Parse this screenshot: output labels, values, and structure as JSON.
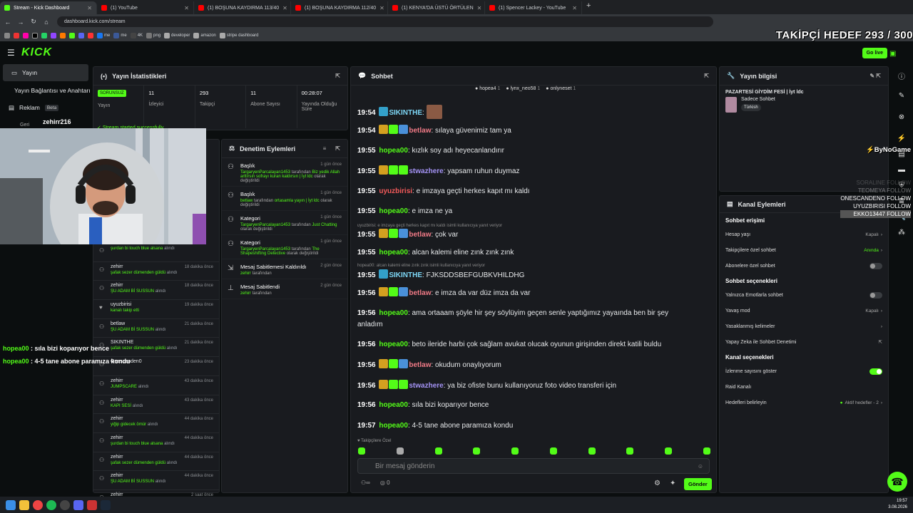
{
  "browser": {
    "tabs": [
      {
        "title": "Stream - Kick Dashboard",
        "active": true
      },
      {
        "title": "(1) YouTube"
      },
      {
        "title": "(1) BOŞUNA KAYDIRMA 113/40"
      },
      {
        "title": "(1) BOŞUNA KAYDIRMA 112/40"
      },
      {
        "title": "(1) KENYA'DA ÜSTÜ ÖRTÜLEN"
      },
      {
        "title": "(1) Spencer Lackey - YouTube"
      }
    ],
    "url": "dashboard.kick.com/stream",
    "bookmarks": [
      "me",
      "me",
      "4K",
      "png",
      "developer",
      "amazon",
      "stripe dashboard"
    ]
  },
  "overlay": {
    "goal": "TAKİPÇİ HEDEF 293 / 300",
    "brand": "ByNoGame",
    "follows": [
      "SORALINE FOLLOW",
      "TEOMEYA FOLLOW",
      "ONESCANDENO FOLLOW",
      "UYUZBIRISI FOLLOW",
      "EKKO13447 FOLLOW"
    ],
    "chat": [
      {
        "user": "hopea00",
        "text": "sıla bizi koparıyor bence"
      },
      {
        "user": "hopea00",
        "text": "4-5 tane abone paramıza kondu"
      }
    ]
  },
  "header": {
    "logo": "KICK",
    "go_live": "Go live"
  },
  "sidebar": {
    "items": [
      {
        "label": "Yayın",
        "active": true
      },
      {
        "label": "Yayın Bağlantısı ve Anahtarı"
      },
      {
        "label": "Reklam",
        "badge": "Beta"
      }
    ],
    "webcam_username": "zehirr216",
    "obscured_item": "Geri"
  },
  "stats": {
    "title": "Yayın İstatistikleri",
    "status": "SORUNSUZ",
    "status_label": "Yayın",
    "items": [
      {
        "value": "11",
        "label": "İzleyici"
      },
      {
        "value": "293",
        "label": "Takipçi"
      },
      {
        "value": "11",
        "label": "Abone Sayısı"
      },
      {
        "value": "00:28:07",
        "label": "Yayında Olduğu Süre"
      }
    ],
    "success": "Stream started successfully"
  },
  "activity": [
    {
      "user": "",
      "desc": "şurdan bi touch blue alsana",
      "suffix": "alındı",
      "time": ""
    },
    {
      "user": "zehirr",
      "desc": "şafak sezer dümenden güldü",
      "suffix": "alındı",
      "time": "18 dakika önce"
    },
    {
      "user": "zehirr",
      "desc": "ŞU ADAM Bİ SUSSUN",
      "suffix": "alındı",
      "time": "18 dakika önce"
    },
    {
      "user": "uyuzbirisi",
      "desc": "kanalı takip etti",
      "suffix": "",
      "time": "19 dakika önce"
    },
    {
      "user": "betlaw",
      "desc": "ŞU ADAM Bİ SUSSUN",
      "suffix": "alındı",
      "time": "21 dakika önce"
    },
    {
      "user": "SIKINTHE",
      "desc": "şafak sezer dümenden güldü",
      "suffix": "alındı",
      "time": "21 dakika önce"
    },
    {
      "user": "Onescanden0",
      "desc": "",
      "suffix": "",
      "time": "23 dakika önce"
    },
    {
      "user": "zehirr",
      "desc": "JUMPSCARE",
      "suffix": "alındı",
      "time": "43 dakika önce"
    },
    {
      "user": "zehirr",
      "desc": "KAPI SESİ",
      "suffix": "alındı",
      "time": "43 dakika önce"
    },
    {
      "user": "zehirr",
      "desc": "yiğip gidecek ömür",
      "suffix": "alındı",
      "time": "44 dakika önce"
    },
    {
      "user": "zehirr",
      "desc": "şurdan bi touch blue alsana",
      "suffix": "alındı",
      "time": "44 dakika önce"
    },
    {
      "user": "zehirr",
      "desc": "şafak sezer dümenden güldü",
      "suffix": "alındı",
      "time": "44 dakika önce"
    },
    {
      "user": "zehirr",
      "desc": "ŞU ADAM Bİ SUSSUN",
      "suffix": "alındı",
      "time": "44 dakika önce"
    },
    {
      "user": "zehirr",
      "desc": "",
      "suffix": "",
      "time": "2 saat önce"
    }
  ],
  "moderation": {
    "title": "Denetim Eylemleri",
    "items": [
      {
        "title": "Başlık",
        "time": "1 gün önce",
        "user": "TargaryenParcalayan1453",
        "mid": "tarafından",
        "value": "Biz yedik Allah arttırsın sofrayı kuran kaldırsın | İyt ldc",
        "end": "olarak değiştirildi"
      },
      {
        "title": "Başlık",
        "time": "1 gün önce",
        "user": "betlaw",
        "mid": "tarafından",
        "value": "ortasamla yayın | İyt ldc",
        "end": "olarak değiştirildi"
      },
      {
        "title": "Kategori",
        "time": "1 gün önce",
        "user": "TargaryenParcalayan1453",
        "mid": "tarafından",
        "value": "Just Chatting",
        "end": "olarak değiştirildi"
      },
      {
        "title": "Kategori",
        "time": "1 gün önce",
        "user": "TargaryenParcalayan1453",
        "mid": "tarafından",
        "value": "The Shapeshifting Detective",
        "end": "olarak değiştirildi"
      },
      {
        "title": "Mesaj Sabitlemesi Kaldırıldı",
        "time": "2 gün önce",
        "user": "zehirr",
        "mid": "tarafından",
        "value": "",
        "end": ""
      },
      {
        "title": "Mesaj Sabitlendi",
        "time": "2 gün önce",
        "user": "zehirr",
        "mid": "tarafından",
        "value": "",
        "end": ""
      }
    ]
  },
  "chat": {
    "title": "Sohbet",
    "top_users": [
      {
        "name": "hopea4",
        "count": "1"
      },
      {
        "name": "lynx_neo58",
        "count": "1"
      },
      {
        "name": "onlyneset",
        "count": "1"
      }
    ],
    "messages": [
      {
        "time": "19:54",
        "user": "SIKINTHE",
        "color": "#7dd6f5",
        "text": "",
        "badges": [
          "#33a0c9"
        ]
      },
      {
        "time": "19:54",
        "user": "betlaw",
        "color": "#f07a86",
        "text": "sılaya güvenimiz tam ya",
        "badges": [
          "#d4a020",
          "#53fc18",
          "#4a90d9"
        ]
      },
      {
        "time": "19:55",
        "user": "hopea00",
        "color": "#53fc18",
        "text": "kızlık soy adı heyecanlandırır",
        "badges": []
      },
      {
        "time": "19:55",
        "user": "stwazhere",
        "color": "#a493f5",
        "text": "yapsam ruhun duymaz",
        "badges": [
          "#d4a020",
          "#53fc18",
          "#53fc18"
        ]
      },
      {
        "time": "19:55",
        "user": "uyuzbirisi",
        "color": "#f35a5a",
        "text": "e imzaya geçti herkes kapıt mı kaldı",
        "badges": []
      },
      {
        "time": "19:55",
        "user": "hopea00",
        "color": "#53fc18",
        "text": "e imza ne ya",
        "badges": []
      },
      {
        "time": "19:55",
        "user": "betlaw",
        "color": "#f07a86",
        "text": "çok var",
        "badges": [
          "#d4a020",
          "#53fc18",
          "#4a90d9"
        ]
      },
      {
        "time": "19:55",
        "user": "hopea00",
        "color": "#53fc18",
        "text": "alcan kalemi eline zınk zınk zınk",
        "badges": []
      },
      {
        "time": "19:55",
        "user": "SIKINTHE",
        "color": "#7dd6f5",
        "text": "FJKSDDSBEFGUBKVHILDHG",
        "badges": [
          "#33a0c9"
        ]
      },
      {
        "time": "19:56",
        "user": "betlaw",
        "color": "#f07a86",
        "text": "e imza da var düz imza da var",
        "badges": [
          "#d4a020",
          "#53fc18",
          "#4a90d9"
        ]
      },
      {
        "time": "19:56",
        "user": "hopea00",
        "color": "#53fc18",
        "text": "ama ortaaam şöyle hir şey söylüyim geçen senle yaptığımız yayaında ben bir şey anladım",
        "badges": []
      },
      {
        "time": "19:56",
        "user": "hopea00",
        "color": "#53fc18",
        "text": "beto ileride harbi çok sağlam avukat olucak oyunun girişinden direkt katili buldu",
        "badges": []
      },
      {
        "time": "19:56",
        "user": "betlaw",
        "color": "#f07a86",
        "text": "okudum onaylıyorum",
        "badges": [
          "#d4a020",
          "#53fc18",
          "#4a90d9"
        ]
      },
      {
        "time": "19:56",
        "user": "stwazhere",
        "color": "#a493f5",
        "text": "ya biz ofiste bunu kullanıyoruz foto video transferi için",
        "badges": [
          "#d4a020",
          "#53fc18",
          "#53fc18"
        ]
      },
      {
        "time": "19:56",
        "user": "hopea00",
        "color": "#53fc18",
        "text": "sıla bizi koparıyor bence",
        "badges": []
      },
      {
        "time": "19:57",
        "user": "hopea00",
        "color": "#53fc18",
        "text": "4-5 tane abone paramıza kondu",
        "badges": []
      }
    ],
    "reply_hints": [
      "uyuzbirisi: e imzaya geçti herkes kapıt mı kaldı isimli kullanıcıya yanıt veriyor",
      "hopea00: alcan kalemi eline zınk zınk isimli kullanıcıya yanıt veriyor"
    ],
    "follower_label": "Takipçilere Özel",
    "input_placeholder": "Bir mesaj gönderin",
    "viewer_count": "0",
    "send": "Gönder"
  },
  "stream_info": {
    "title": "Yayın bilgisi",
    "stream_title": "PAZARTESİ GİYDİM FESİ | İyt ldc",
    "category": "Sadece Sohbet",
    "language": "Türkish"
  },
  "channel_actions": {
    "title": "Kanal Eylemleri",
    "access_title": "Sohbet erişimi",
    "access": [
      {
        "label": "Hesap yaşı",
        "value": "Kapalı"
      },
      {
        "label": "Takipçilere özel sohbet",
        "value": "Anında"
      },
      {
        "label": "Abonelere özel sohbet",
        "value": ""
      }
    ],
    "options_title": "Sohbet seçenekleri",
    "options": [
      {
        "label": "Yalnızca Emotlarla sohbet",
        "value": ""
      },
      {
        "label": "Yavaş mod",
        "value": "Kapalı"
      },
      {
        "label": "Yasaklanmış kelimeler",
        "value": ""
      },
      {
        "label": "Yapay Zeka ile Sohbet Denetimi",
        "value": ""
      }
    ],
    "channel_title": "Kanal seçenekleri",
    "channel": [
      {
        "label": "İzlenme sayısını göster",
        "value": ""
      },
      {
        "label": "Raid Kanalı",
        "value": ""
      },
      {
        "label": "Hedefleri belirleyin",
        "value": "Aktif hedefler - 2"
      }
    ]
  },
  "clock": {
    "time": "19:57",
    "date": "3.08.2026"
  }
}
